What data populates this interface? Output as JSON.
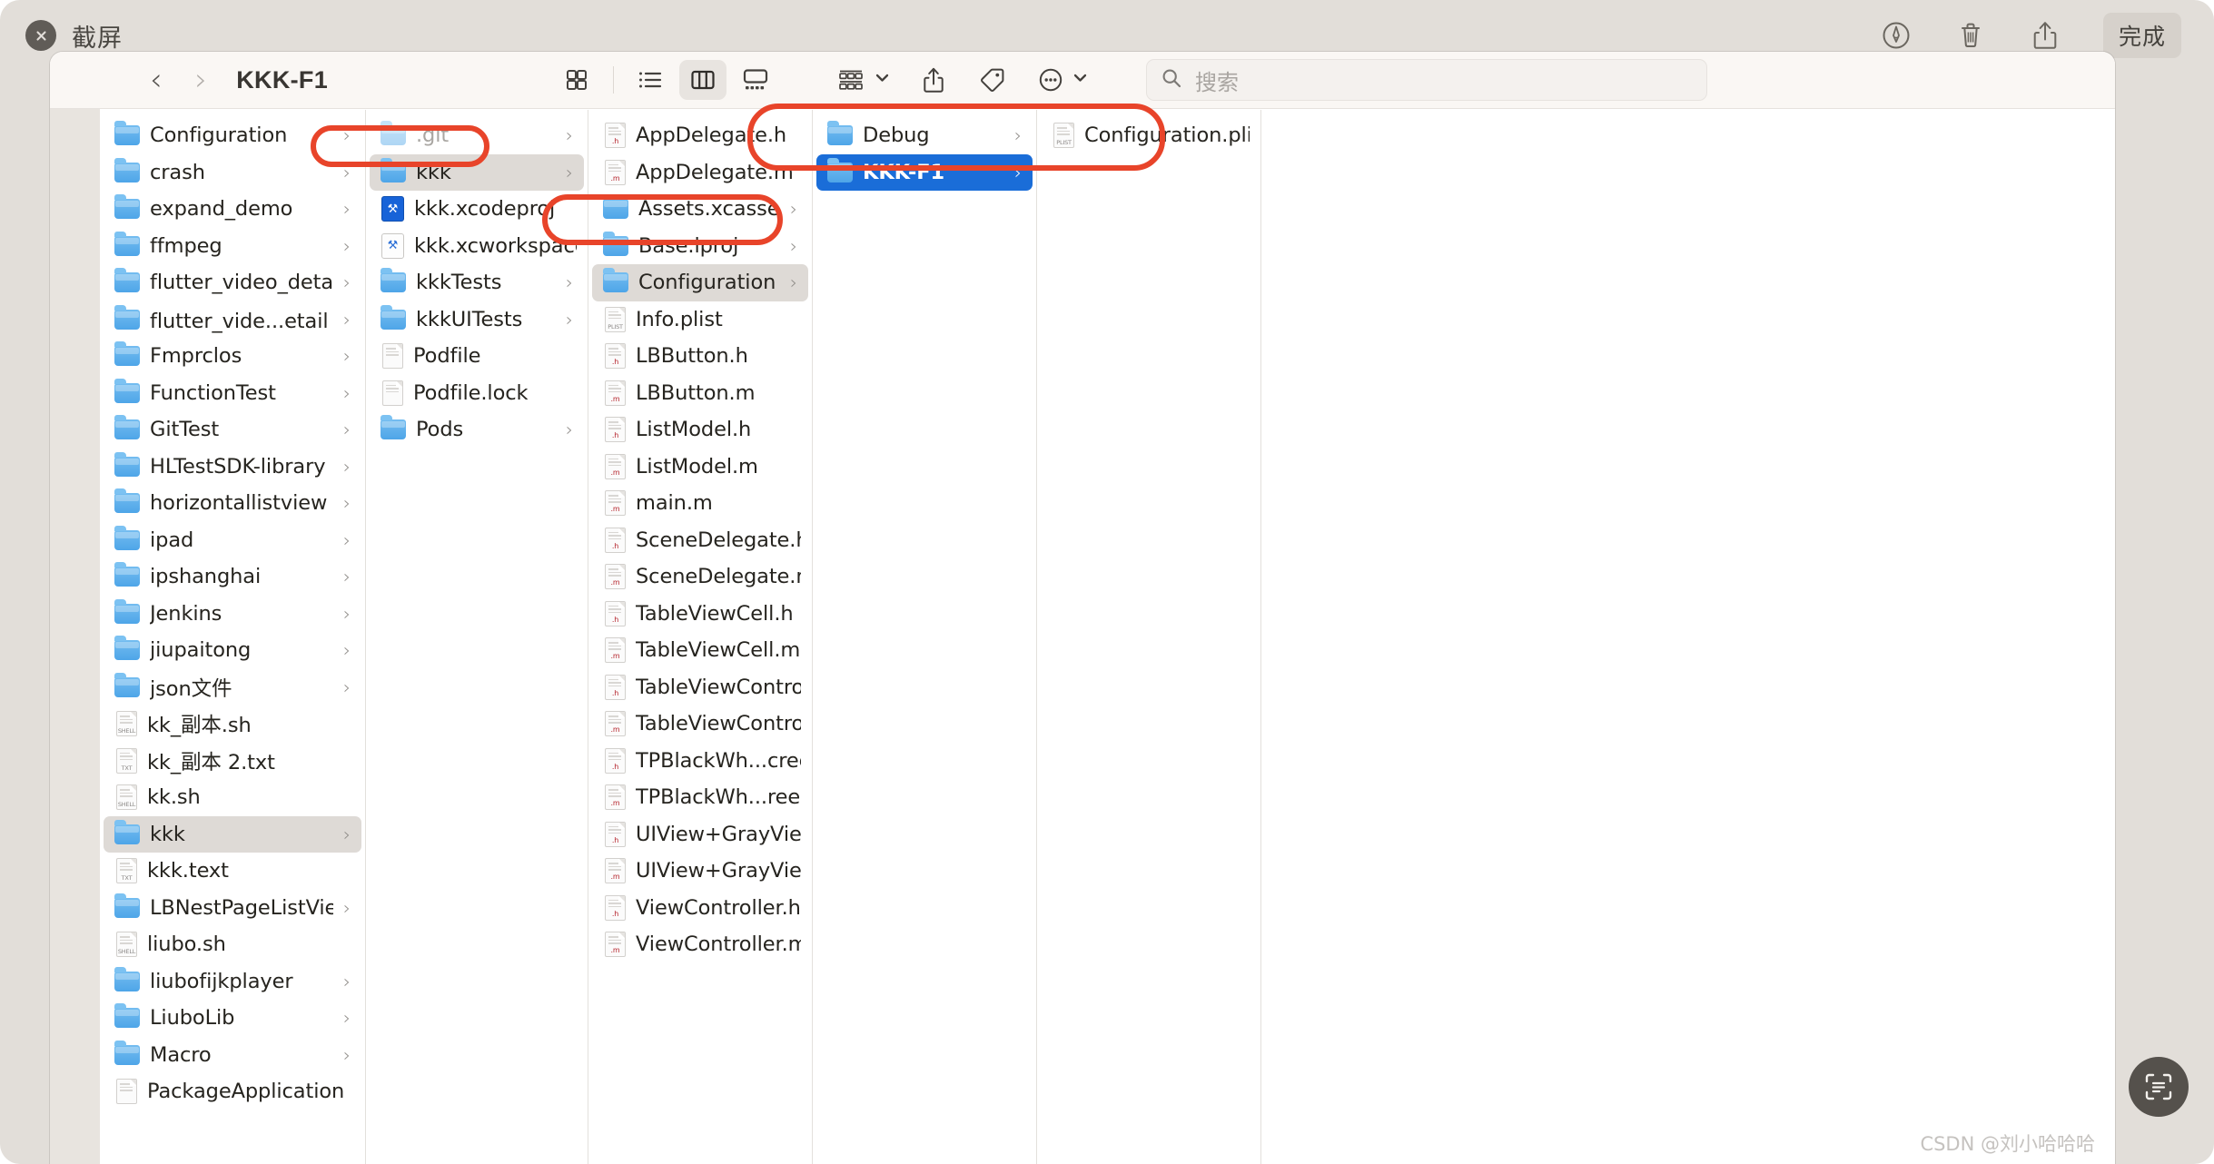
{
  "window": {
    "title": "截屏",
    "close_icon": "close-icon",
    "toolbar": {
      "markup_icon": "markup-pen-icon",
      "trash_icon": "trash-icon",
      "share_icon": "share-icon",
      "done_label": "完成"
    }
  },
  "finder": {
    "path_title": "KKK-F1",
    "back_label": "‹",
    "forward_label": "›",
    "views": [
      {
        "name": "icon-view-button",
        "active": false
      },
      {
        "name": "list-view-button",
        "active": false
      },
      {
        "name": "column-view-button",
        "active": true
      },
      {
        "name": "gallery-view-button",
        "active": false
      }
    ],
    "actions": [
      {
        "name": "group-by-button",
        "icon": "group-grid-icon",
        "has_chevron": true
      },
      {
        "name": "share-button",
        "icon": "share-icon",
        "has_chevron": false
      },
      {
        "name": "tag-button",
        "icon": "tag-icon",
        "has_chevron": false
      },
      {
        "name": "more-options-button",
        "icon": "ellipsis-circle-icon",
        "has_chevron": true
      }
    ],
    "search": {
      "placeholder": "搜索",
      "value": "",
      "icon": "search-icon"
    }
  },
  "columns": [
    {
      "id": "col-1",
      "items": [
        {
          "label": "Configuration",
          "type": "folder",
          "arrow": true
        },
        {
          "label": "crash",
          "type": "folder",
          "arrow": true
        },
        {
          "label": "expand_demo",
          "type": "folder",
          "arrow": true
        },
        {
          "label": "ffmpeg",
          "type": "folder",
          "arrow": true
        },
        {
          "label": "flutter_video_detail",
          "type": "folder",
          "arrow": true
        },
        {
          "label": "flutter_vide...etail 的副本",
          "type": "folder",
          "arrow": true
        },
        {
          "label": "Fmprclos",
          "type": "folder",
          "arrow": true
        },
        {
          "label": "FunctionTest",
          "type": "folder",
          "arrow": true
        },
        {
          "label": "GitTest",
          "type": "folder",
          "arrow": true
        },
        {
          "label": "HLTestSDK-library",
          "type": "folder",
          "arrow": true
        },
        {
          "label": "horizontallistview",
          "type": "folder",
          "arrow": true
        },
        {
          "label": "ipad",
          "type": "folder",
          "arrow": true
        },
        {
          "label": "ipshanghai",
          "type": "folder",
          "arrow": true
        },
        {
          "label": "Jenkins",
          "type": "folder",
          "arrow": true
        },
        {
          "label": "jiupaitong",
          "type": "folder",
          "arrow": true
        },
        {
          "label": "json文件",
          "type": "folder",
          "arrow": true
        },
        {
          "label": "kk_副本.sh",
          "type": "file",
          "ext": "SHELL",
          "arrow": false
        },
        {
          "label": "kk_副本 2.txt",
          "type": "file",
          "ext": "TXT",
          "arrow": false
        },
        {
          "label": "kk.sh",
          "type": "file",
          "ext": "SHELL",
          "arrow": false
        },
        {
          "label": "kkk",
          "type": "folder",
          "arrow": true,
          "selected": "gray"
        },
        {
          "label": "kkk.text",
          "type": "file",
          "ext": "TXT",
          "arrow": false
        },
        {
          "label": "LBNestPageListView",
          "type": "folder",
          "arrow": true
        },
        {
          "label": "liubo.sh",
          "type": "file",
          "ext": "SHELL",
          "arrow": false
        },
        {
          "label": "liubofijkplayer",
          "type": "folder",
          "arrow": true
        },
        {
          "label": "LiuboLib",
          "type": "folder",
          "arrow": true
        },
        {
          "label": "Macro",
          "type": "folder",
          "arrow": true
        },
        {
          "label": "PackageApplication",
          "type": "file",
          "ext": "",
          "arrow": false,
          "clipped": true
        }
      ]
    },
    {
      "id": "col-2",
      "items": [
        {
          "label": ".git",
          "type": "folder",
          "arrow": true,
          "dim": true
        },
        {
          "label": "kkk",
          "type": "folder",
          "arrow": true,
          "selected": "gray"
        },
        {
          "label": "kkk.xcodeproj",
          "type": "xcodeproj",
          "arrow": false
        },
        {
          "label": "kkk.xcworkspace",
          "type": "xcworkspace",
          "arrow": false
        },
        {
          "label": "kkkTests",
          "type": "folder",
          "arrow": true
        },
        {
          "label": "kkkUITests",
          "type": "folder",
          "arrow": true
        },
        {
          "label": "Podfile",
          "type": "file",
          "ext": "",
          "arrow": false
        },
        {
          "label": "Podfile.lock",
          "type": "file",
          "ext": "",
          "arrow": false
        },
        {
          "label": "Pods",
          "type": "folder",
          "arrow": true
        }
      ]
    },
    {
      "id": "col-3",
      "items": [
        {
          "label": "AppDelegate.h",
          "type": "file",
          "ext": ".h",
          "arrow": false
        },
        {
          "label": "AppDelegate.m",
          "type": "file",
          "ext": ".m",
          "arrow": false
        },
        {
          "label": "Assets.xcassets",
          "type": "folder",
          "arrow": true
        },
        {
          "label": "Base.lproj",
          "type": "folder",
          "arrow": true
        },
        {
          "label": "Configuration",
          "type": "folder",
          "arrow": true,
          "selected": "gray"
        },
        {
          "label": "Info.plist",
          "type": "file",
          "ext": "PLIST",
          "arrow": false
        },
        {
          "label": "LBButton.h",
          "type": "file",
          "ext": ".h",
          "arrow": false
        },
        {
          "label": "LBButton.m",
          "type": "file",
          "ext": ".m",
          "arrow": false
        },
        {
          "label": "ListModel.h",
          "type": "file",
          "ext": ".h",
          "arrow": false
        },
        {
          "label": "ListModel.m",
          "type": "file",
          "ext": ".m",
          "arrow": false
        },
        {
          "label": "main.m",
          "type": "file",
          "ext": ".m",
          "arrow": false
        },
        {
          "label": "SceneDelegate.h",
          "type": "file",
          "ext": ".h",
          "arrow": false
        },
        {
          "label": "SceneDelegate.m",
          "type": "file",
          "ext": ".m",
          "arrow": false
        },
        {
          "label": "TableViewCell.h",
          "type": "file",
          "ext": ".h",
          "arrow": false
        },
        {
          "label": "TableViewCell.m",
          "type": "file",
          "ext": ".m",
          "arrow": false
        },
        {
          "label": "TableViewController.h",
          "type": "file",
          "ext": ".h",
          "arrow": false
        },
        {
          "label": "TableViewController.m",
          "type": "file",
          "ext": ".m",
          "arrow": false
        },
        {
          "label": "TPBlackWh...creenTool.h",
          "type": "file",
          "ext": ".h",
          "arrow": false
        },
        {
          "label": "TPBlackWh...reenTool.m",
          "type": "file",
          "ext": ".m",
          "arrow": false
        },
        {
          "label": "UIView+GrayView.h",
          "type": "file",
          "ext": ".h",
          "arrow": false
        },
        {
          "label": "UIView+GrayView.m",
          "type": "file",
          "ext": ".m",
          "arrow": false
        },
        {
          "label": "ViewController.h",
          "type": "file",
          "ext": ".h",
          "arrow": false
        },
        {
          "label": "ViewController.m",
          "type": "file",
          "ext": ".m",
          "arrow": false
        }
      ]
    },
    {
      "id": "col-4",
      "items": [
        {
          "label": "Debug",
          "type": "folder",
          "arrow": true
        },
        {
          "label": "KKK-F1",
          "type": "folder",
          "arrow": true,
          "selected": "blue"
        }
      ]
    },
    {
      "id": "col-5",
      "items": [
        {
          "label": "Configuration.plist",
          "type": "file",
          "ext": "PLIST",
          "arrow": false
        }
      ]
    },
    {
      "id": "col-6",
      "items": []
    }
  ],
  "annotations": [
    {
      "name": "annotation-box-kkk",
      "color": "#e8442a"
    },
    {
      "name": "annotation-box-configuration",
      "color": "#e8442a"
    },
    {
      "name": "annotation-box-debug-kkkf1",
      "color": "#e8442a"
    }
  ],
  "overlay": {
    "watermark": "CSDN @刘小哈哈哈",
    "scan_icon": "text-scan-icon"
  }
}
